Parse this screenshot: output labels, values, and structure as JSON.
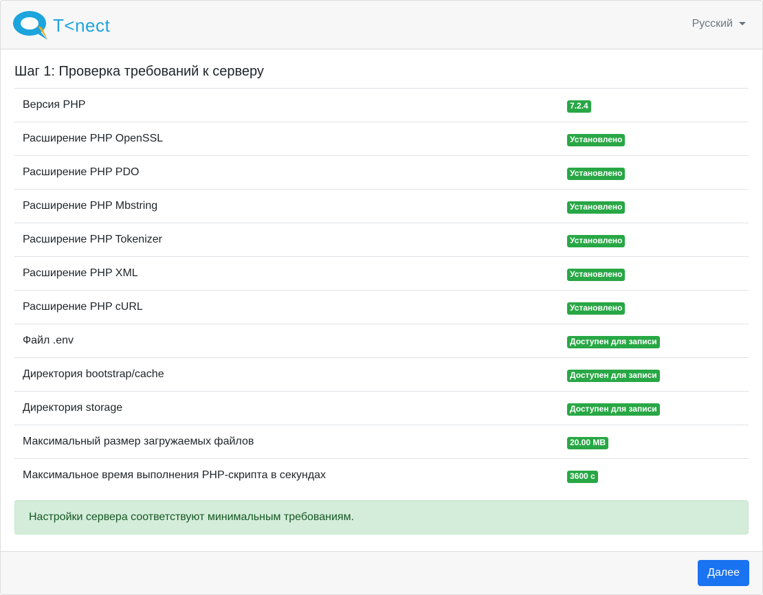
{
  "header": {
    "logo_text": "T<nect",
    "language_label": "Русский",
    "brand_color": "#1ca4dd"
  },
  "main": {
    "title": "Шаг 1: Проверка требований к серверу",
    "requirements": [
      {
        "name": "Версия PHP",
        "status": "7.2.4"
      },
      {
        "name": "Расширение PHP OpenSSL",
        "status": "Установлено"
      },
      {
        "name": "Расширение PHP PDO",
        "status": "Установлено"
      },
      {
        "name": "Расширение PHP Mbstring",
        "status": "Установлено"
      },
      {
        "name": "Расширение PHP Tokenizer",
        "status": "Установлено"
      },
      {
        "name": "Расширение PHP XML",
        "status": "Установлено"
      },
      {
        "name": "Расширение PHP cURL",
        "status": "Установлено"
      },
      {
        "name": "Файл .env",
        "status": "Доступен для записи"
      },
      {
        "name": "Директория bootstrap/cache",
        "status": "Доступен для записи"
      },
      {
        "name": "Директория storage",
        "status": "Доступен для записи"
      },
      {
        "name": "Максимальный размер загружаемых файлов",
        "status": "20.00 MB"
      },
      {
        "name": "Максимальное время выполнения PHP-скрипта в секундах",
        "status": "3600 с"
      }
    ],
    "success_message": "Настройки сервера соответствуют минимальным требованиям.",
    "status_color": "#28a745"
  },
  "footer": {
    "next_label": "Далее",
    "button_color": "#1a73f0"
  }
}
